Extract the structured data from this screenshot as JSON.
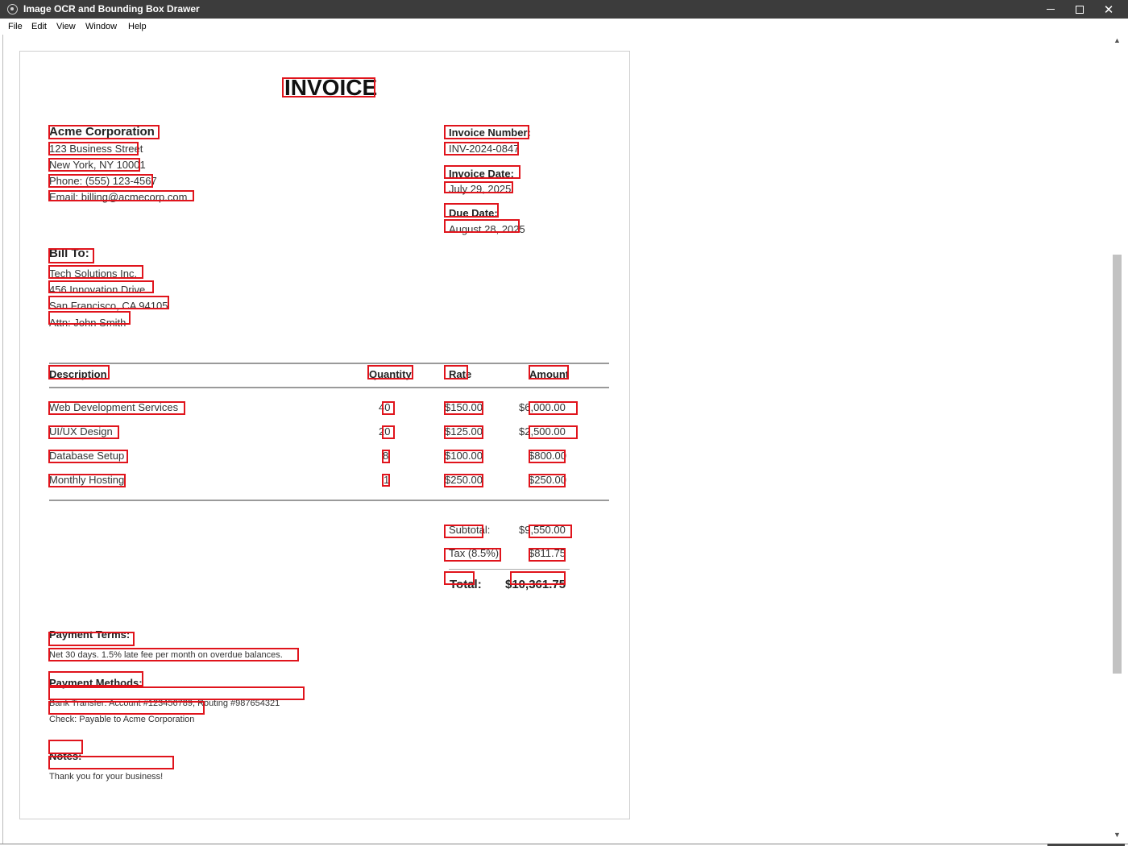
{
  "window": {
    "title": "Image OCR and Bounding Box Drawer",
    "icon": "app-icon",
    "controls": {
      "minimize": "minimize",
      "maximize": "maximize",
      "close": "✕"
    }
  },
  "menu": [
    "File",
    "Edit",
    "View",
    "Window",
    "Help"
  ],
  "invoice": {
    "title": "INVOICE",
    "company": {
      "name": "Acme Corporation",
      "street": "123 Business Street",
      "city": "New York, NY 10001",
      "phone": "Phone: (555) 123-4567",
      "email": "Email: billing@acmecorp.com"
    },
    "meta": {
      "number_label": "Invoice Number:",
      "number": "INV-2024-0847",
      "date_label": "Invoice Date:",
      "date": "July 29, 2025",
      "due_label": "Due Date:",
      "due": "August 28, 2025"
    },
    "bill_to": {
      "label": "Bill To:",
      "name": "Tech Solutions Inc.",
      "street": "456 Innovation Drive",
      "city": "San Francisco, CA 94105",
      "attn": "Attn: John Smith"
    },
    "table": {
      "headers": [
        "Description",
        "Quantity",
        "Rate",
        "Amount"
      ],
      "rows": [
        [
          "Web Development Services",
          "40",
          "$150.00",
          "$6,000.00"
        ],
        [
          "UI/UX Design",
          "20",
          "$125.00",
          "$2,500.00"
        ],
        [
          "Database Setup",
          "8",
          "$100.00",
          "$800.00"
        ],
        [
          "Monthly Hosting",
          "1",
          "$250.00",
          "$250.00"
        ]
      ]
    },
    "totals": {
      "subtotal_label": "Subtotal:",
      "subtotal": "$9,550.00",
      "tax_label": "Tax (8.5%):",
      "tax": "$811.75",
      "total_label": "Total:",
      "total": "$10,361.75"
    },
    "payment_terms": {
      "label": "Payment Terms:",
      "text": "Net 30 days. 1.5% late fee per month on overdue balances."
    },
    "payment_methods": {
      "label": "Payment Methods:",
      "bank": "Bank Transfer: Account #123456789, Routing #987654321",
      "check": "Check: Payable to Acme Corporation"
    },
    "notes": {
      "label": "Notes:",
      "text": "Thank you for your business!"
    }
  },
  "overlay": {
    "box_color": "#e0141c"
  },
  "scrollbar": {
    "position_fraction": 0.33
  }
}
